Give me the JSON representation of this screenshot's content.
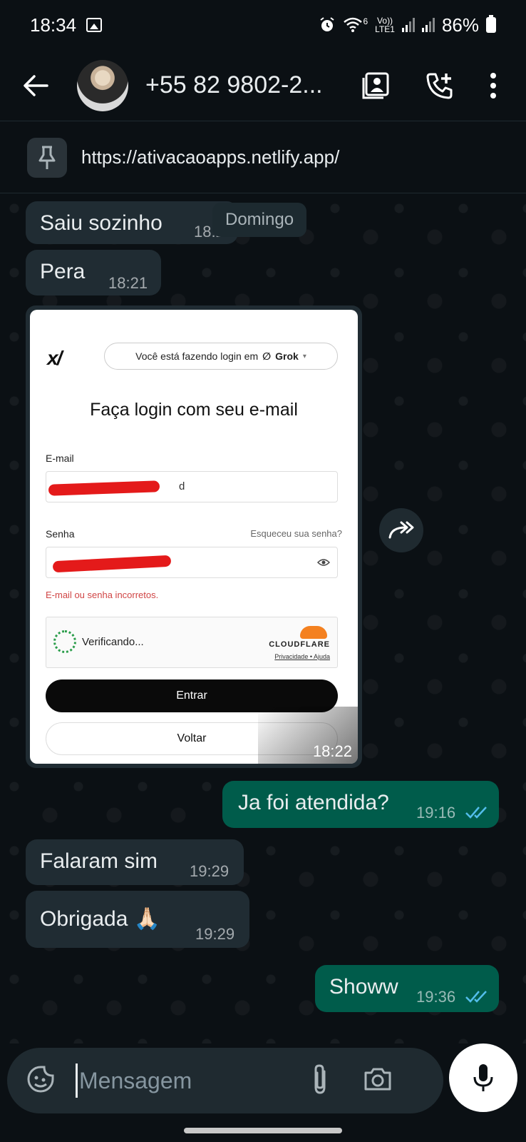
{
  "status_bar": {
    "time": "18:34",
    "network_label": "LTE1",
    "volte_label": "Vo))",
    "wifi_label": "6",
    "battery": "86%"
  },
  "header": {
    "contact_name": "+55 82 9802-2..."
  },
  "pinned": {
    "url": "https://ativacaoapps.netlify.app/"
  },
  "chat": {
    "date_chip": "Domingo",
    "messages": [
      {
        "text": "Saiu sozinho",
        "time": "18:21",
        "direction": "in"
      },
      {
        "text": "Pera",
        "time": "18:21",
        "direction": "in"
      },
      {
        "text": "",
        "time": "18:22",
        "direction": "in",
        "type": "image"
      },
      {
        "text": "Ja foi atendida?",
        "time": "19:16",
        "direction": "out",
        "status": "read"
      },
      {
        "text": "Falaram sim",
        "time": "19:29",
        "direction": "in"
      },
      {
        "text": "Obrigada 🙏🏻",
        "time": "19:29",
        "direction": "in"
      },
      {
        "text": "Showw",
        "time": "19:36",
        "direction": "out",
        "status": "read"
      }
    ]
  },
  "image_screenshot": {
    "login_pill_prefix": "Você está fazendo login em",
    "login_pill_brand": "Grok",
    "heading": "Faça login com seu e-mail",
    "email_label": "E-mail",
    "email_visible_suffix": "d",
    "password_label": "Senha",
    "forgot_link": "Esqueceu sua senha?",
    "error_text": "E-mail ou senha incorretos.",
    "captcha_status": "Verificando...",
    "captcha_brand": "CLOUDFLARE",
    "captcha_links": "Privacidade • Ajuda",
    "submit_label": "Entrar",
    "back_label": "Voltar"
  },
  "composer": {
    "placeholder": "Mensagem"
  },
  "colors": {
    "background": "#0b1014",
    "incoming_bubble": "#202c33",
    "outgoing_bubble": "#005c4b",
    "read_ticks": "#53bdeb"
  }
}
